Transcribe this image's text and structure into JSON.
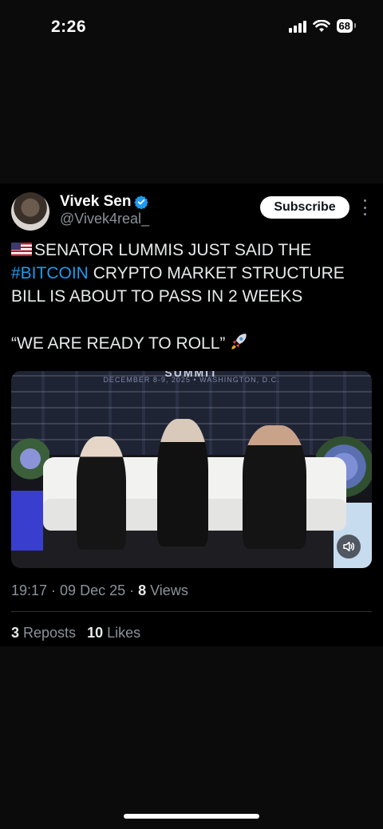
{
  "status_bar": {
    "time": "2:26",
    "battery": "68"
  },
  "post": {
    "author_name": "Vivek Sen",
    "handle": "@Vivek4real_",
    "subscribe_label": "Subscribe",
    "text_part1": "SENATOR LUMMIS JUST SAID THE ",
    "hashtag": "#BITCOIN",
    "text_part2": " CRYPTO MARKET STRUCTURE BILL IS ABOUT TO PASS IN 2 WEEKS",
    "quote": "“WE ARE READY TO ROLL”",
    "media": {
      "banner_title": "SUMMIT",
      "banner_subtitle": "DECEMBER 8-9, 2025 • WASHINGTON, D.C."
    },
    "meta": {
      "time": "19:17",
      "sep1": " · ",
      "date": "09 Dec 25",
      "sep2": " · ",
      "views": "8",
      "views_label": " Views"
    },
    "stats": {
      "reposts": "3",
      "reposts_label": " Reposts",
      "likes": "10",
      "likes_label": " Likes"
    }
  },
  "colors": {
    "accent": "#1d9bf0",
    "background": "#000000",
    "muted": "#8b9299"
  },
  "icons": [
    "verified-icon",
    "more-icon",
    "rocket-icon",
    "volume-icon",
    "us-flag-icon",
    "signal-icon",
    "wifi-icon",
    "battery-icon"
  ]
}
